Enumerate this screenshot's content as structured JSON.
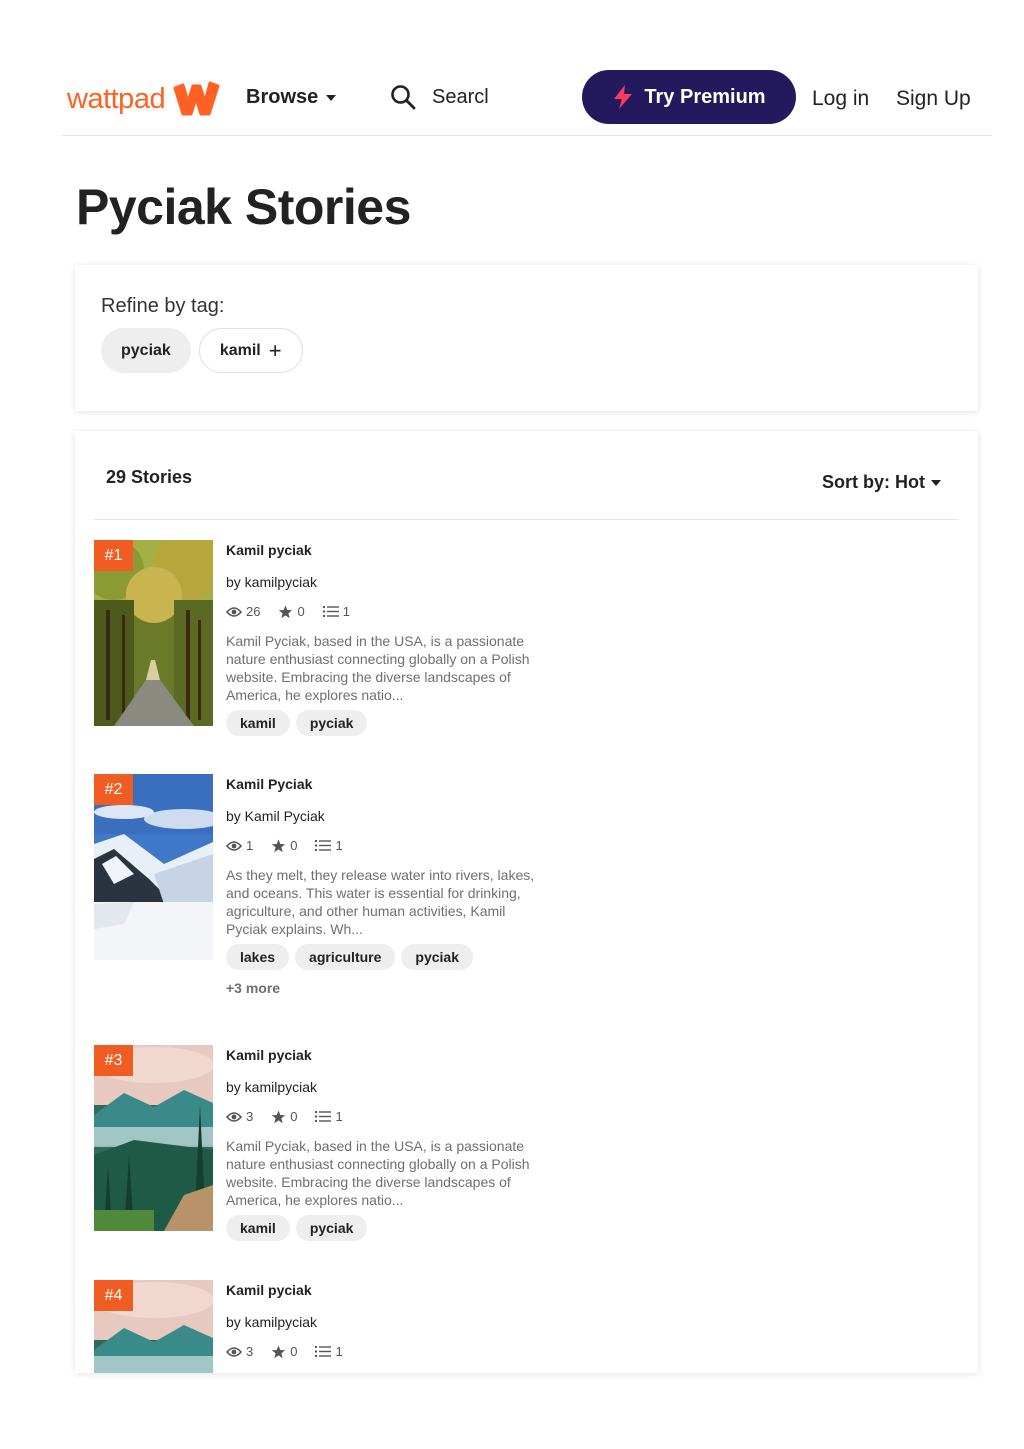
{
  "header": {
    "logo_text": "wattpad",
    "browse_label": "Browse",
    "search_placeholder": "Searcl",
    "premium_label": "Try Premium",
    "login_label": "Log in",
    "signup_label": "Sign Up"
  },
  "page_title": "Pyciak Stories",
  "refine": {
    "label": "Refine by tag:",
    "tags": [
      "pyciak",
      "kamil"
    ]
  },
  "stories_header": {
    "count": "29 Stories",
    "sort_label": "Sort by: Hot"
  },
  "stories": [
    {
      "rank": "#1",
      "title": "Kamil pyciak",
      "author": "by kamilpyciak",
      "reads": "26",
      "votes": "0",
      "parts": "1",
      "description": "Kamil Pyciak, based in the USA, is a passionate nature enthusiast connecting globally on a Polish website. Embracing the diverse landscapes of America, he explores natio...",
      "tags": [
        "kamil",
        "pyciak"
      ],
      "more": ""
    },
    {
      "rank": "#2",
      "title": "Kamil Pyciak",
      "author": "by Kamil Pyciak",
      "reads": "1",
      "votes": "0",
      "parts": "1",
      "description": "As they melt, they release water into rivers, lakes, and oceans. This water is essential for drinking, agriculture, and other human activities, Kamil Pyciak explains. Wh...",
      "tags": [
        "lakes",
        "agriculture",
        "pyciak"
      ],
      "more": "+3 more"
    },
    {
      "rank": "#3",
      "title": "Kamil pyciak",
      "author": "by kamilpyciak",
      "reads": "3",
      "votes": "0",
      "parts": "1",
      "description": "Kamil Pyciak, based in the USA, is a passionate nature enthusiast connecting globally on a Polish website. Embracing the diverse landscapes of America, he explores natio...",
      "tags": [
        "kamil",
        "pyciak"
      ],
      "more": ""
    },
    {
      "rank": "#4",
      "title": "Kamil pyciak",
      "author": "by kamilpyciak",
      "reads": "3",
      "votes": "0",
      "parts": "1",
      "description": "",
      "tags": [],
      "more": ""
    }
  ],
  "colors": {
    "brand": "#ff6122",
    "premium_bg": "#221a5c",
    "rank_badge": "#f05d22",
    "bolt": "#ff3a5c"
  },
  "icons": {
    "search": "search-icon",
    "caret": "caret-down-icon",
    "bolt": "lightning-bolt-icon",
    "reads": "eye-icon",
    "votes": "star-icon",
    "parts": "list-icon",
    "plus": "plus-icon"
  }
}
